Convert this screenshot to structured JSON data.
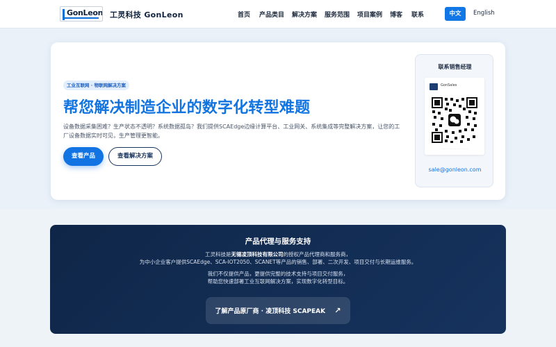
{
  "header": {
    "logo_text": "GonLeon",
    "brand_name": "工灵科技 GonLeon",
    "nav": [
      {
        "label": "首页"
      },
      {
        "label": "产品类目"
      },
      {
        "label": "解决方案"
      },
      {
        "label": "服务范围"
      },
      {
        "label": "项目案例"
      },
      {
        "label": "博客"
      },
      {
        "label": "联系"
      }
    ],
    "lang_active": "中文",
    "lang_other": "English",
    "accent_color": "#1176e6"
  },
  "hero": {
    "tag": "工业互联网 · 物联网解决方案",
    "title": "帮您解决制造企业的数字化转型难题",
    "description": "设备数据采集困难？生产状态不透明？系统数据孤岛？我们提供SCAEdge边缘计算平台、工业网关、系统集成等完整解决方案，让您的工厂设备数据实时可见，生产管理更智能。",
    "primary_button": "查看产品",
    "secondary_button": "查看解决方案"
  },
  "contact": {
    "title": "联系销售经理",
    "qr_name": "GonSales",
    "qr_icon": "qr-code-icon",
    "email": "sale@gonleon.com"
  },
  "agent_section": {
    "title": "产品代理与服务支持",
    "line1_prefix": "工灵科技是",
    "line1_strong": "无锡凌顶科技有限公司",
    "line1_suffix": "的授权产品代理商和服务商，",
    "line2": "为中小企业客户提供SCAEdge、SCA-IOT2050、SCANET等产品的销售、部署、二次开发、项目交付与长期运维服务。",
    "line3": "我们不仅提供产品，更提供完整的技术支持与项目交付服务，",
    "line4": "帮助您快速部署工业互联网解决方案，实现数字化转型目标。",
    "button_label": "了解产品原厂商 · 凌顶科技 SCAPEAK",
    "button_arrow": "↗"
  }
}
